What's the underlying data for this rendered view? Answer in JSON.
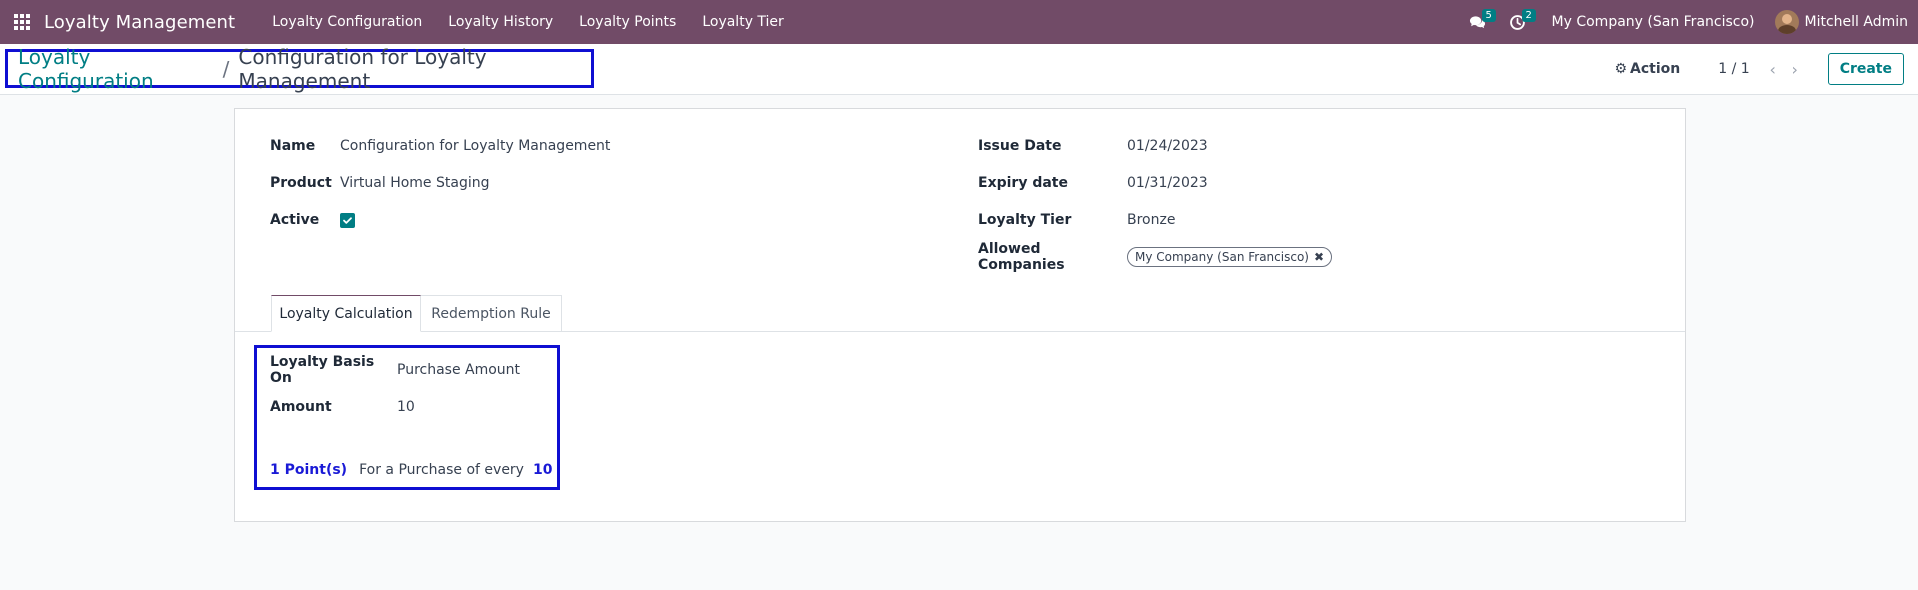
{
  "navbar": {
    "app_title": "Loyalty Management",
    "menu": [
      "Loyalty Configuration",
      "Loyalty History",
      "Loyalty Points",
      "Loyalty Tier"
    ],
    "messages_count": "5",
    "activities_count": "2",
    "company": "My Company (San Francisco)",
    "user": "Mitchell Admin",
    "icons": [
      "apps-grid-icon",
      "chat-icon",
      "clock-icon"
    ]
  },
  "control_panel": {
    "breadcrumb_parent": "Loyalty Configuration",
    "breadcrumb_separator": "/",
    "breadcrumb_current": "Configuration for Loyalty Management",
    "action_label": "Action",
    "pager": "1 / 1",
    "create_label": "Create"
  },
  "form": {
    "left": {
      "name_label": "Name",
      "name_value": "Configuration for Loyalty Management",
      "product_label": "Product",
      "product_value": "Virtual Home Staging",
      "active_label": "Active",
      "active_checked": true
    },
    "right": {
      "issue_date_label": "Issue Date",
      "issue_date_value": "01/24/2023",
      "expiry_date_label": "Expiry date",
      "expiry_date_value": "01/31/2023",
      "loyalty_tier_label": "Loyalty Tier",
      "loyalty_tier_value": "Bronze",
      "allowed_companies_label": "Allowed Companies",
      "allowed_companies": [
        "My Company (San Francisco)"
      ]
    },
    "tabs": [
      {
        "label": "Loyalty Calculation",
        "active": true
      },
      {
        "label": "Redemption Rule",
        "active": false
      }
    ],
    "calculation": {
      "basis_label": "Loyalty Basis On",
      "basis_value": "Purchase Amount",
      "amount_label": "Amount",
      "amount_value": "10",
      "points_text": "1 Point(s)",
      "purchase_text": "For a Purchase of every",
      "purchase_value": "10"
    }
  },
  "colors": {
    "navbar": "#714b67",
    "accent": "#017e84",
    "highlight_border": "#0f0fd2"
  }
}
